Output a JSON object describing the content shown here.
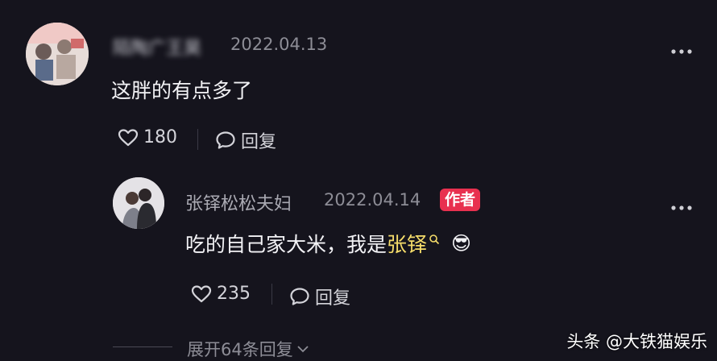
{
  "comment1": {
    "username": "陌陶广王昊",
    "date": "2022.04.13",
    "text": "这胖的有点多了",
    "likes": "180",
    "reply_label": "回复"
  },
  "reply1": {
    "username": "张铎松松夫妇",
    "date": "2022.04.14",
    "badge": "作者",
    "text_before": "吃的自己家大米，我是",
    "mention": "张铎",
    "emoji": "😎",
    "likes": "235",
    "reply_label": "回复"
  },
  "expand_label": "展开64条回复",
  "watermark": "头条 @大铁猫娱乐",
  "colors": {
    "background": "#15141d",
    "badge": "#e8304f",
    "mention": "#f5dc6a"
  }
}
